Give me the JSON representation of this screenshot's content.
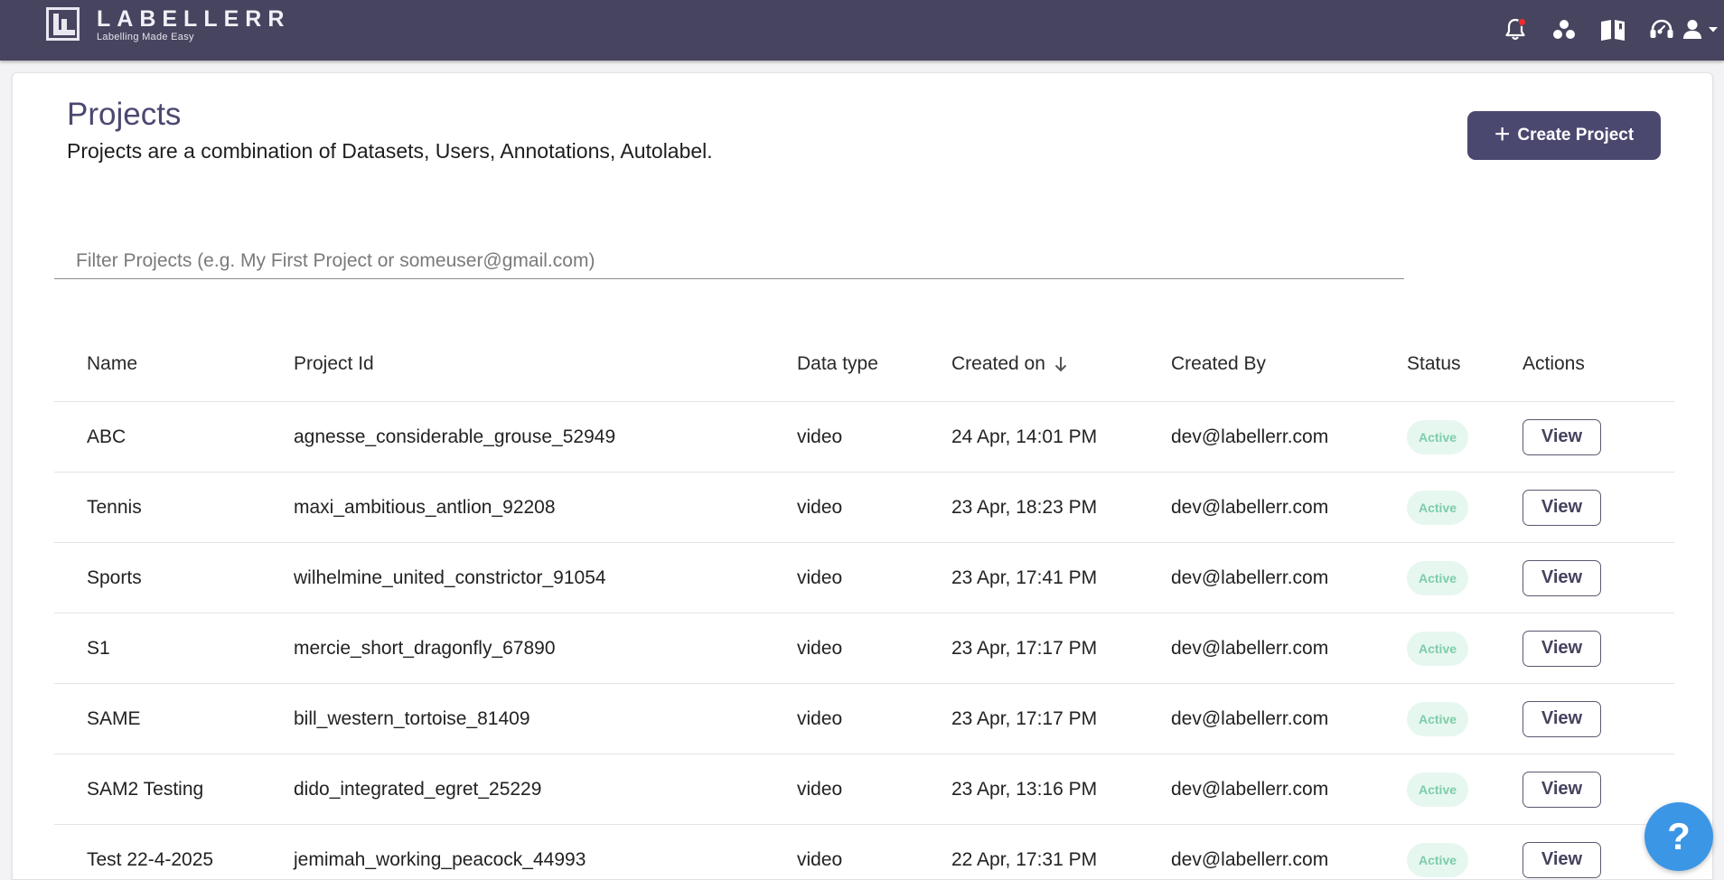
{
  "header": {
    "brand_name": "LABELLERR",
    "brand_tagline": "Labelling Made Easy",
    "icons": [
      "notifications-icon",
      "workspace-icon",
      "docs-book-icon",
      "support-headset-icon",
      "account-icon"
    ]
  },
  "page": {
    "title": "Projects",
    "subtitle": "Projects are a combination of Datasets, Users, Annotations, Autolabel.",
    "create_label": "Create Project",
    "filter_placeholder": "Filter Projects (e.g. My First Project or someuser@gmail.com)",
    "filter_value": ""
  },
  "table": {
    "columns": {
      "name": "Name",
      "project_id": "Project Id",
      "data_type": "Data type",
      "created_on": "Created on",
      "created_by": "Created By",
      "status": "Status",
      "actions": "Actions"
    },
    "sorted_by": "created_on",
    "sort_direction": "desc",
    "rows": [
      {
        "name": "ABC",
        "project_id": "agnesse_considerable_grouse_52949",
        "data_type": "video",
        "created_on": "24 Apr, 14:01 PM",
        "created_by": "dev@labellerr.com",
        "status": "Active",
        "action": "View"
      },
      {
        "name": "Tennis",
        "project_id": "maxi_ambitious_antlion_92208",
        "data_type": "video",
        "created_on": "23 Apr, 18:23 PM",
        "created_by": "dev@labellerr.com",
        "status": "Active",
        "action": "View"
      },
      {
        "name": "Sports",
        "project_id": "wilhelmine_united_constrictor_91054",
        "data_type": "video",
        "created_on": "23 Apr, 17:41 PM",
        "created_by": "dev@labellerr.com",
        "status": "Active",
        "action": "View"
      },
      {
        "name": "S1",
        "project_id": "mercie_short_dragonfly_67890",
        "data_type": "video",
        "created_on": "23 Apr, 17:17 PM",
        "created_by": "dev@labellerr.com",
        "status": "Active",
        "action": "View"
      },
      {
        "name": "SAME",
        "project_id": "bill_western_tortoise_81409",
        "data_type": "video",
        "created_on": "23 Apr, 17:17 PM",
        "created_by": "dev@labellerr.com",
        "status": "Active",
        "action": "View"
      },
      {
        "name": "SAM2 Testing",
        "project_id": "dido_integrated_egret_25229",
        "data_type": "video",
        "created_on": "23 Apr, 13:16 PM",
        "created_by": "dev@labellerr.com",
        "status": "Active",
        "action": "View"
      },
      {
        "name": "Test 22-4-2025",
        "project_id": "jemimah_working_peacock_44993",
        "data_type": "video",
        "created_on": "22 Apr, 17:31 PM",
        "created_by": "dev@labellerr.com",
        "status": "Active",
        "action": "View"
      }
    ]
  },
  "help": {
    "label": "?"
  },
  "colors": {
    "topbar": "#47445f",
    "accent": "#4b4870",
    "status_active_bg": "#e6f7ef",
    "status_active_text": "#7ccdaa",
    "notification_dot": "#ef2b2b",
    "help_button": "#3c96e6"
  }
}
